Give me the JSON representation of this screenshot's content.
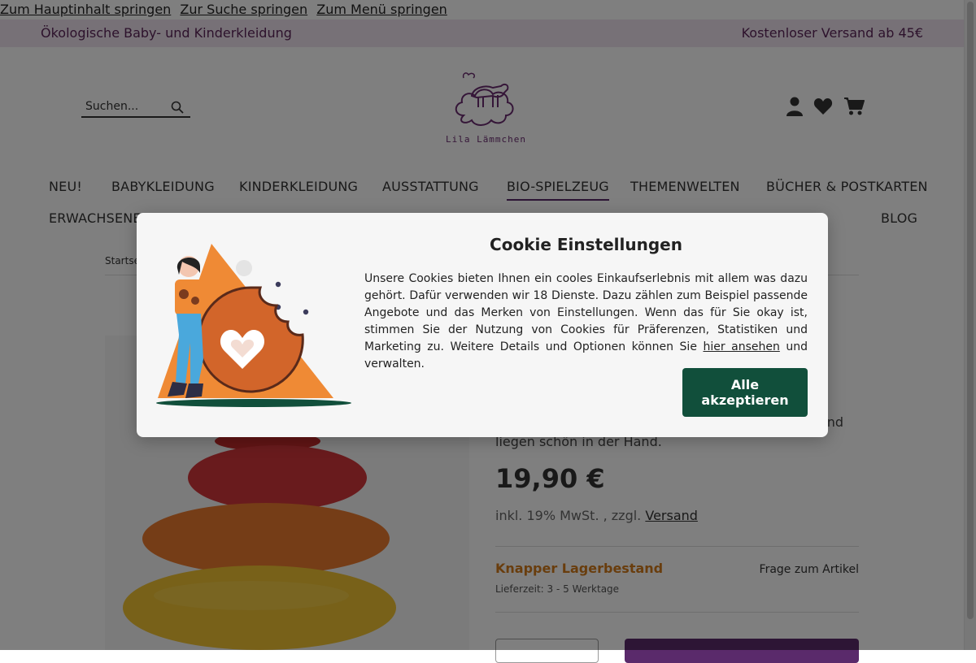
{
  "skip_links": [
    "Zum Hauptinhalt springen",
    "Zur Suche springen",
    "Zum Menü springen"
  ],
  "topbar": {
    "left": "Ökologische Baby- und Kinderkleidung",
    "right": "Kostenloser Versand ab 45€"
  },
  "search": {
    "placeholder": "Suchen..."
  },
  "logo": {
    "text": "Lila Lämmchen"
  },
  "nav": {
    "items": [
      "NEU!",
      "BABYKLEIDUNG",
      "KINDERKLEIDUNG",
      "AUSSTATTUNG",
      "BIO-SPIELZEUG",
      "THEMENWELTEN",
      "BÜCHER & POSTKARTEN",
      "ERWACHSENE",
      "BLOG"
    ],
    "active": "BIO-SPIELZEUG"
  },
  "breadcrumb": {
    "first": "Startse"
  },
  "product": {
    "desc_fragment_right": "nd",
    "desc_line2": "liegen schön in der Hand.",
    "price": "19,90 €",
    "tax_text": "inkl. 19% MwSt. , zzgl.",
    "shipping_link": "Versand",
    "stock": "Knapper Lagerbestand",
    "delivery": "Lieferzeit: 3 - 5 Werktage",
    "question": "Frage zum Artikel"
  },
  "cookie": {
    "title": "Cookie Einstellungen",
    "text_before_link": "Unsere Cookies bieten Ihnen ein cooles Einkaufserlebnis mit allem was dazu gehört. Dafür verwenden wir 18 Dienste. Dazu zählen zum Beispiel passende Angebote und das Merken von Einstellungen. Wenn das für Sie okay ist, stimmen Sie der Nutzung von Cookies für Präferenzen, Statistiken und Marketing zu. Weitere Details und Optionen können Sie",
    "link": "hier ansehen",
    "text_after_link": "und verwalten.",
    "accept_button": "Alle akzeptieren"
  },
  "colors": {
    "topbar_bg": "#efe3ef",
    "brand_purple": "#5a2a6b",
    "accept_green": "#114f3b",
    "stock_orange": "#d27a1a"
  },
  "icons": [
    "search-icon",
    "user-icon",
    "heart-icon",
    "cart-icon",
    "sheep-logo"
  ]
}
